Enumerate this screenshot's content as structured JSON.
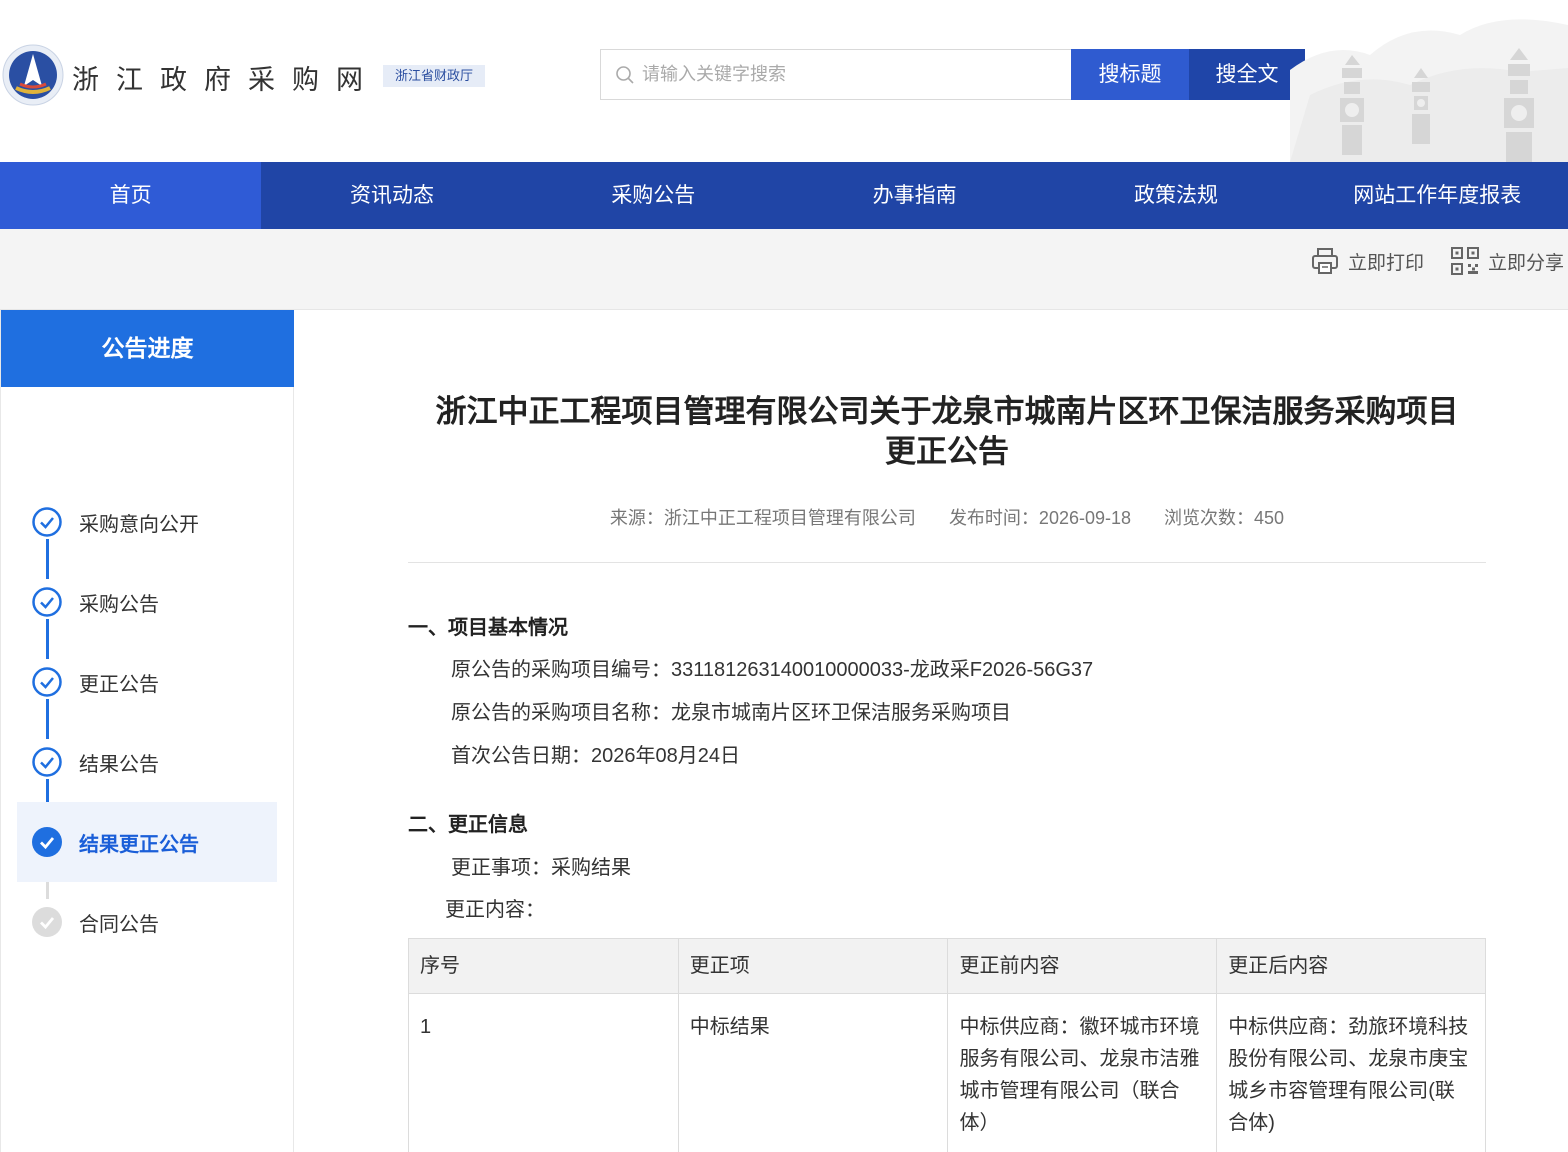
{
  "header": {
    "site_title": "浙江政府采购网",
    "dept_badge": "浙江省财政厅",
    "search_placeholder": "请输入关键字搜索",
    "btn_search_title": "搜标题",
    "btn_search_full": "搜全文"
  },
  "nav": {
    "items": [
      "首页",
      "资讯动态",
      "采购公告",
      "办事指南",
      "政策法规",
      "网站工作年度报表"
    ],
    "active_index": 0
  },
  "toolbar": {
    "print_label": "立即打印",
    "share_label": "立即分享"
  },
  "sidebar": {
    "heading": "公告进度",
    "steps": [
      {
        "label": "采购意向公开",
        "status": "done"
      },
      {
        "label": "采购公告",
        "status": "done"
      },
      {
        "label": "更正公告",
        "status": "done"
      },
      {
        "label": "结果公告",
        "status": "done"
      },
      {
        "label": "结果更正公告",
        "status": "current"
      },
      {
        "label": "合同公告",
        "status": "pending"
      }
    ]
  },
  "article": {
    "title_line1": "浙江中正工程项目管理有限公司关于龙泉市城南片区环卫保洁服务采购项目",
    "title_line2": "更正公告",
    "source": "来源：浙江中正工程项目管理有限公司",
    "publish_time": "发布时间：2026-09-18",
    "views": "浏览次数：450",
    "section1_title": "一、项目基本情况",
    "project_code": "原公告的采购项目编号：33118126314001000003​3-龙政采F2026-56G37",
    "project_name": "原公告的采购项目名称：龙泉市城南片区环卫保洁服务采购项目",
    "first_date": "首次公告日期：2026年08月24日",
    "section2_title": "二、更正信息",
    "correction_item": "更正事项：采购结果",
    "correction_content": "更正内容："
  },
  "table": {
    "headers": [
      "序号",
      "更正项",
      "更正前内容",
      "更正后内容"
    ],
    "rows": [
      [
        "1",
        "中标结果",
        "中标供应商：徽环城市环境服务有限公司、龙泉市洁雅城市管理有限公司（联合体）",
        "中标供应商：劲旅环境科技股份有限公司、龙泉市庚宝城乡市容管理有限公司(联合体)"
      ]
    ]
  },
  "colors": {
    "nav_bg": "#2045a6",
    "nav_active": "#2f5bd6",
    "sidebar_head": "#1f6fe0",
    "step_done": "#1f6fe0",
    "step_pending": "#d9d9d9"
  }
}
